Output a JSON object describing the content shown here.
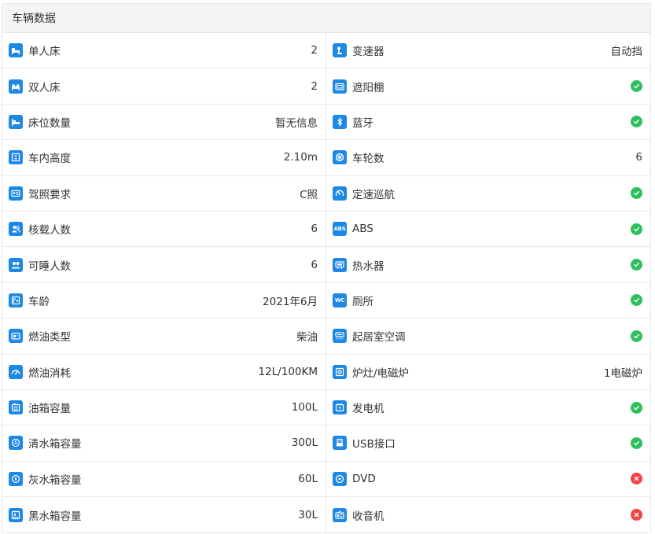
{
  "panel": {
    "title": "车辆数据"
  },
  "colors": {
    "icon": "#1e88e5",
    "yes": "#2ec05c",
    "no": "#f04646"
  },
  "left": [
    {
      "label": "单人床",
      "value": "2",
      "icon": "single-bed-icon"
    },
    {
      "label": "双人床",
      "value": "2",
      "icon": "double-bed-icon"
    },
    {
      "label": "床位数量",
      "value": "暂无信息",
      "icon": "berth-icon"
    },
    {
      "label": "车内高度",
      "value": "2.10m",
      "icon": "height-icon"
    },
    {
      "label": "驾照要求",
      "value": "C照",
      "icon": "license-icon"
    },
    {
      "label": "核载人数",
      "value": "6",
      "icon": "passengers-icon"
    },
    {
      "label": "可睡人数",
      "value": "6",
      "icon": "sleepers-icon"
    },
    {
      "label": "车龄",
      "value": "2021年6月",
      "icon": "vehicle-age-icon"
    },
    {
      "label": "燃油类型",
      "value": "柴油",
      "icon": "fuel-type-icon"
    },
    {
      "label": "燃油消耗",
      "value": "12L/100KM",
      "icon": "fuel-gauge-icon"
    },
    {
      "label": "油箱容量",
      "value": "100L",
      "icon": "fuel-tank-icon"
    },
    {
      "label": "清水箱容量",
      "value": "300L",
      "icon": "fresh-water-icon"
    },
    {
      "label": "灰水箱容量",
      "value": "60L",
      "icon": "gray-water-icon"
    },
    {
      "label": "黑水箱容量",
      "value": "30L",
      "icon": "black-water-icon"
    }
  ],
  "right": [
    {
      "label": "变速器",
      "value": "自动挡",
      "icon": "transmission-icon"
    },
    {
      "label": "遮阳棚",
      "status": "yes",
      "icon": "awning-icon"
    },
    {
      "label": "蓝牙",
      "status": "yes",
      "icon": "bluetooth-icon"
    },
    {
      "label": "车轮数",
      "value": "6",
      "icon": "wheel-icon"
    },
    {
      "label": "定速巡航",
      "status": "yes",
      "icon": "cruise-control-icon"
    },
    {
      "label": "ABS",
      "status": "yes",
      "icon": "abs-icon",
      "icon_text": "ABS"
    },
    {
      "label": "热水器",
      "status": "yes",
      "icon": "water-heater-icon"
    },
    {
      "label": "厕所",
      "status": "yes",
      "icon": "toilet-icon",
      "icon_text": "WC"
    },
    {
      "label": "起居室空调",
      "status": "yes",
      "icon": "air-conditioner-icon"
    },
    {
      "label": "炉灶/电磁炉",
      "value": "1电磁炉",
      "icon": "stove-icon"
    },
    {
      "label": "发电机",
      "status": "yes",
      "icon": "generator-icon"
    },
    {
      "label": "USB接口",
      "status": "yes",
      "icon": "usb-icon"
    },
    {
      "label": "DVD",
      "status": "no",
      "icon": "dvd-icon"
    },
    {
      "label": "收音机",
      "status": "no",
      "icon": "radio-icon"
    }
  ]
}
